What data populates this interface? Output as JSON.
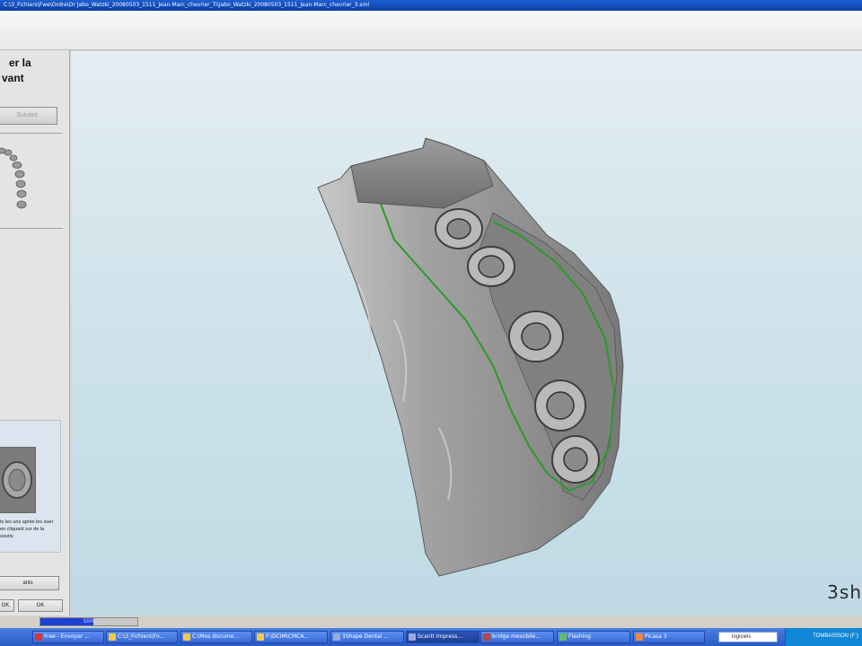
{
  "window": {
    "title": "C:\\3_Fichiers\\Fwe\\Ordre\\Dr Jabo_Watzki_20080503_1511_Jean-Marc_chevrier_Ti\\Jabo_Watzki_20080503_1511_Jean-Marc_chevrier_3.sml"
  },
  "left_panel": {
    "instruction_line1": "er la",
    "instruction_line2": "vant",
    "next_button": "Suivant",
    "help_text": "ts les uns après les suer en cliquant sur de la souris",
    "wide_button": "ants",
    "small_button_left": "OK",
    "small_button_right": "OK"
  },
  "viewport": {
    "logo": "3sh"
  },
  "progress": {
    "value_percent": 55,
    "label": "55%"
  },
  "taskbar": {
    "tasks": [
      {
        "label": "Free - Envoyer ...",
        "color": "#d33"
      },
      {
        "label": "C:\\3_Fichiers\\Fo...",
        "color": "#f2c94c"
      },
      {
        "label": "C:\\Mes docume...",
        "color": "#f2c94c"
      },
      {
        "label": "F:\\DCIM\\CMCA...",
        "color": "#f2c94c"
      },
      {
        "label": "3Shape Dental ...",
        "color": "#9ad"
      },
      {
        "label": "ScanIt Impress...",
        "color": "#9ad"
      },
      {
        "label": "bridge mesobile...",
        "color": "#b44"
      },
      {
        "label": "Flashing",
        "color": "#6b6"
      },
      {
        "label": "Picasa 3",
        "color": "#e84"
      }
    ],
    "search_text": "logiciels",
    "tray_time": "TOMBAISSON (F:)"
  },
  "colors": {
    "margin_line": "#2a9a2a",
    "model_fill": "#9a9a9a"
  }
}
